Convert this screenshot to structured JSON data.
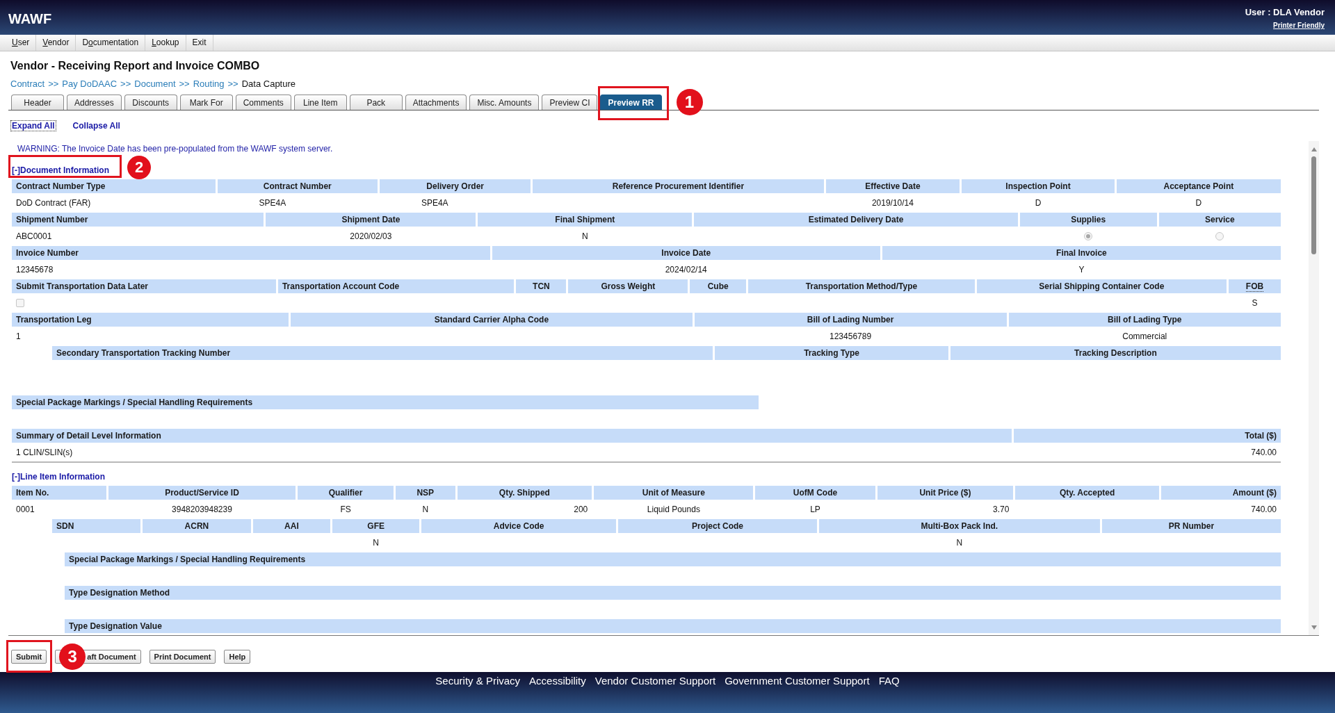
{
  "header": {
    "logo": "WAWF",
    "user": "User : DLA Vendor",
    "printer_link": "Printer Friendly"
  },
  "menu": [
    {
      "parts": [
        {
          "text": "U",
          "underlined": true
        },
        {
          "text": "ser",
          "underlined": false
        }
      ]
    },
    {
      "parts": [
        {
          "text": "V",
          "underlined": true
        },
        {
          "text": "endor",
          "underlined": false
        }
      ]
    },
    {
      "parts": [
        {
          "text": "D",
          "underlined": false
        },
        {
          "text": "o",
          "underlined": true
        },
        {
          "text": "cumentation",
          "underlined": false
        }
      ]
    },
    {
      "parts": [
        {
          "text": "L",
          "underlined": true
        },
        {
          "text": "ookup",
          "underlined": false
        }
      ]
    },
    {
      "parts": [
        {
          "text": "Exit",
          "underlined": false
        }
      ]
    }
  ],
  "page_title": "Vendor - Receiving Report and Invoice COMBO",
  "breadcrumb": [
    {
      "label": "Contract",
      "link": true,
      "separator": ">>"
    },
    {
      "label": "Pay DoDAAC",
      "link": true,
      "separator": ">>"
    },
    {
      "label": "Document",
      "link": true,
      "separator": ">>"
    },
    {
      "label": "Routing",
      "link": true,
      "separator": ">>"
    },
    {
      "label": "Data Capture",
      "link": false
    }
  ],
  "tabs": [
    {
      "label": "Header",
      "selected": false
    },
    {
      "label": "Addresses",
      "selected": false
    },
    {
      "label": "Discounts",
      "selected": false
    },
    {
      "label": "Mark For",
      "selected": false
    },
    {
      "label": "Comments",
      "selected": false
    },
    {
      "label": "Line Item",
      "selected": false
    },
    {
      "label": "Pack",
      "selected": false
    },
    {
      "label": "Attachments",
      "selected": false
    },
    {
      "label": "Misc. Amounts",
      "selected": false
    },
    {
      "label": "Preview CI",
      "selected": false
    },
    {
      "label": "Preview RR",
      "selected": true,
      "callout": "1"
    }
  ],
  "view_links": [
    {
      "label": "Expand All",
      "focused": true
    },
    {
      "label": "Collapse All",
      "focused": false
    }
  ],
  "warning": "WARNING: The Invoice Date has been pre-populated from the WAWF system server.",
  "document_information": {
    "heading": "[-]Document Information",
    "callout": "2",
    "groups": [
      {
        "columns": [
          {
            "header": "Contract Number Type",
            "value": "DoD Contract (FAR)"
          },
          {
            "header": "Contract Number",
            "value": "SPE4A"
          },
          {
            "header": "Delivery Order",
            "value": "SPE4A"
          },
          {
            "header": "Reference Procurement Identifier"
          },
          {
            "header": "Effective Date",
            "value": "2019/10/14"
          },
          {
            "header": "Inspection Point",
            "value": "D"
          },
          {
            "header": "Acceptance Point",
            "value": "D"
          }
        ]
      },
      {
        "columns": [
          {
            "header": "Shipment Number",
            "kind": "text",
            "value": "ABC0001"
          },
          {
            "header": "Shipment Date",
            "kind": "text",
            "value": "2020/02/03"
          },
          {
            "header": "Final Shipment",
            "kind": "text",
            "value": "N"
          },
          {
            "header": "Estimated Delivery Date",
            "kind": "text"
          },
          {
            "header": "Supplies",
            "kind": "radio",
            "selected": true
          },
          {
            "header": "Service",
            "kind": "radio",
            "selected": false
          }
        ]
      },
      {
        "columns": [
          {
            "header": "Invoice Number",
            "value": "12345678"
          },
          {
            "header": "Invoice Date",
            "value": "2024/02/14"
          },
          {
            "header": "Final Invoice",
            "value": "Y"
          }
        ]
      },
      {
        "columns": [
          {
            "header": "Submit Transportation Data Later",
            "kind": "checkbox",
            "checked": false
          },
          {
            "header": "Transportation Account Code",
            "kind": "text"
          },
          {
            "header": "TCN",
            "kind": "text"
          },
          {
            "header": "Gross Weight",
            "kind": "text"
          },
          {
            "header": "Cube",
            "kind": "text"
          },
          {
            "header": "Transportation Method/Type",
            "kind": "text"
          },
          {
            "header": "Serial Shipping Container Code",
            "kind": "text"
          },
          {
            "header": "FOB",
            "kind": "text",
            "abbreviation": true,
            "value": "S"
          }
        ]
      },
      {
        "columns": [
          {
            "header": "Transportation Leg",
            "value": "1"
          },
          {
            "header": "Standard Carrier Alpha Code"
          },
          {
            "header": "Bill of Lading Number",
            "value": "123456789"
          },
          {
            "header": "Bill of Lading Type",
            "value": "Commercial"
          }
        ],
        "children": [
          {
            "columns": [
              {
                "header": "Secondary Transportation Tracking Number"
              },
              {
                "header": "Tracking Type"
              },
              {
                "header": "Tracking Description"
              }
            ]
          }
        ]
      },
      {
        "columns": [
          {
            "header": "Special Package Markings / Special Handling Requirements"
          }
        ]
      },
      {
        "columns": [
          {
            "header": "Summary of Detail Level Information",
            "value": "1 CLIN/SLIN(s)"
          },
          {
            "header": "Total ($)",
            "value": "740.00"
          }
        ]
      }
    ]
  },
  "line_item_information": {
    "heading": "[-]Line Item Information",
    "groups": [
      {
        "columns": [
          {
            "header": "Item No.",
            "value": "0001"
          },
          {
            "header": "Product/Service ID",
            "value": "3948203948239"
          },
          {
            "header": "Qualifier",
            "value": "FS"
          },
          {
            "header": "NSP",
            "value": "N"
          },
          {
            "header": "Qty. Shipped",
            "value": "200"
          },
          {
            "header": "Unit of Measure",
            "value": "Liquid Pounds"
          },
          {
            "header": "UofM Code",
            "value": "LP"
          },
          {
            "header": "Unit Price ($)",
            "value": "3.70"
          },
          {
            "header": "Qty. Accepted"
          },
          {
            "header": "Amount ($)",
            "value": "740.00"
          }
        ],
        "children": [
          {
            "columns": [
              {
                "header": "SDN"
              },
              {
                "header": "ACRN"
              },
              {
                "header": "AAI"
              },
              {
                "header": "GFE",
                "value": "N"
              },
              {
                "header": "Advice Code"
              },
              {
                "header": "Project Code"
              },
              {
                "header": "Multi-Box Pack Ind.",
                "value": "N"
              },
              {
                "header": "PR Number"
              }
            ],
            "children": [
              {
                "columns": [
                  {
                    "header": "Special Package Markings / Special Handling Requirements"
                  }
                ]
              },
              {
                "columns": [
                  {
                    "header": "Type Designation Method"
                  }
                ]
              },
              {
                "columns": [
                  {
                    "header": "Type Designation Value"
                  }
                ]
              }
            ]
          }
        ]
      }
    ]
  },
  "buttons": [
    {
      "label": "Submit",
      "callout": "3"
    },
    {
      "label": "aft Document"
    },
    {
      "label": "Print Document"
    },
    {
      "label": "Help"
    }
  ],
  "footer_links": [
    "Security & Privacy",
    "Accessibility",
    "Vendor Customer Support",
    "Government Customer Support",
    "FAQ"
  ]
}
